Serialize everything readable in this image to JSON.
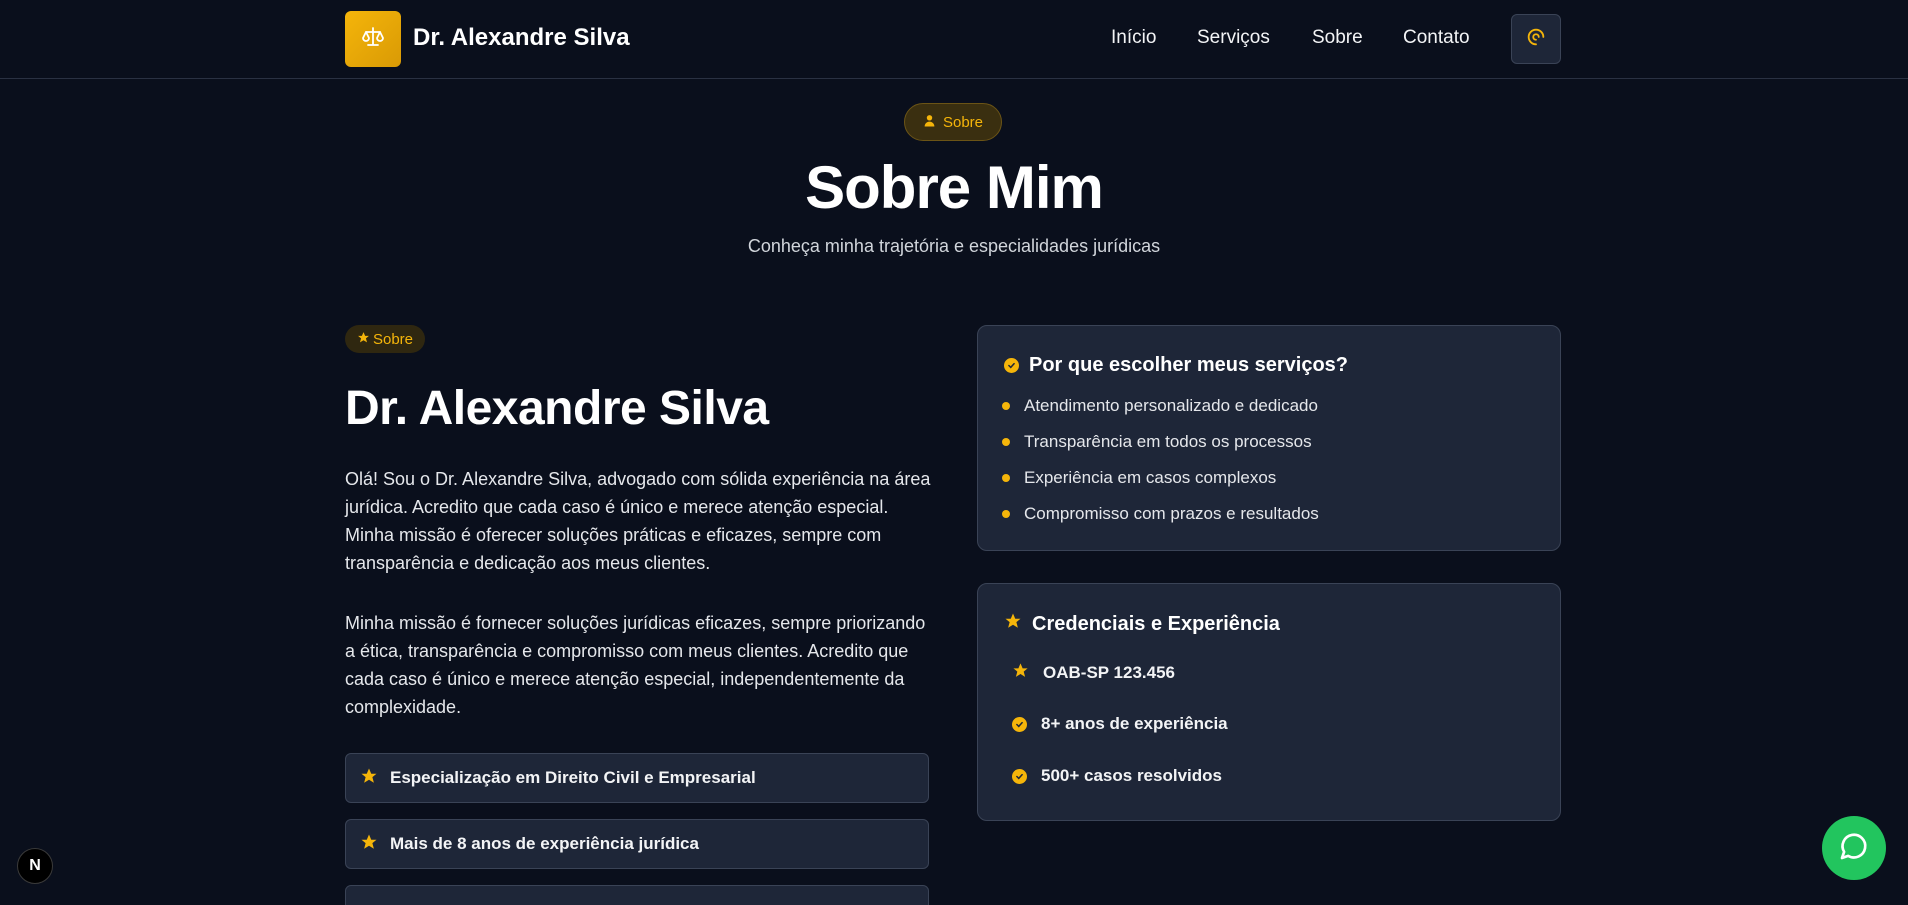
{
  "header": {
    "brand": "Dr. Alexandre Silva",
    "logo_icon": "scales-icon",
    "nav": [
      "Início",
      "Serviços",
      "Sobre",
      "Contato"
    ],
    "theme_icon": "theme-toggle-icon"
  },
  "hero": {
    "badge": "Sobre",
    "title": "Sobre Mim",
    "subtitle": "Conheça minha trajetória e especialidades jurídicas"
  },
  "about": {
    "badge": "Sobre",
    "name": "Dr. Alexandre Silva",
    "paragraph1": "Olá! Sou o Dr. Alexandre Silva, advogado com sólida experiência na área jurídica. Acredito que cada caso é único e merece atenção especial. Minha missão é oferecer soluções práticas e eficazes, sempre com transparência e dedicação aos meus clientes.",
    "paragraph2": "Minha missão é fornecer soluções jurídicas eficazes, sempre priorizando a ética, transparência e compromisso com meus clientes. Acredito que cada caso é único e merece atenção especial, independentemente da complexidade.",
    "features": [
      "Especialização em Direito Civil e Empresarial",
      "Mais de 8 anos de experiência jurídica"
    ]
  },
  "why_card": {
    "title": "Por que escolher meus serviços?",
    "items": [
      "Atendimento personalizado e dedicado",
      "Transparência em todos os processos",
      "Experiência em casos complexos",
      "Compromisso com prazos e resultados"
    ]
  },
  "cred_card": {
    "title": "Credenciais e Experiência",
    "items": [
      "OAB-SP 123.456",
      "8+ anos de experiência",
      "500+ casos resolvidos"
    ]
  },
  "colors": {
    "accent": "#f5b50a",
    "background": "#0a0f1c",
    "card": "#1e2638",
    "whatsapp": "#22c55e"
  },
  "floating": {
    "next_badge": "N",
    "whatsapp_icon": "whatsapp-icon"
  }
}
